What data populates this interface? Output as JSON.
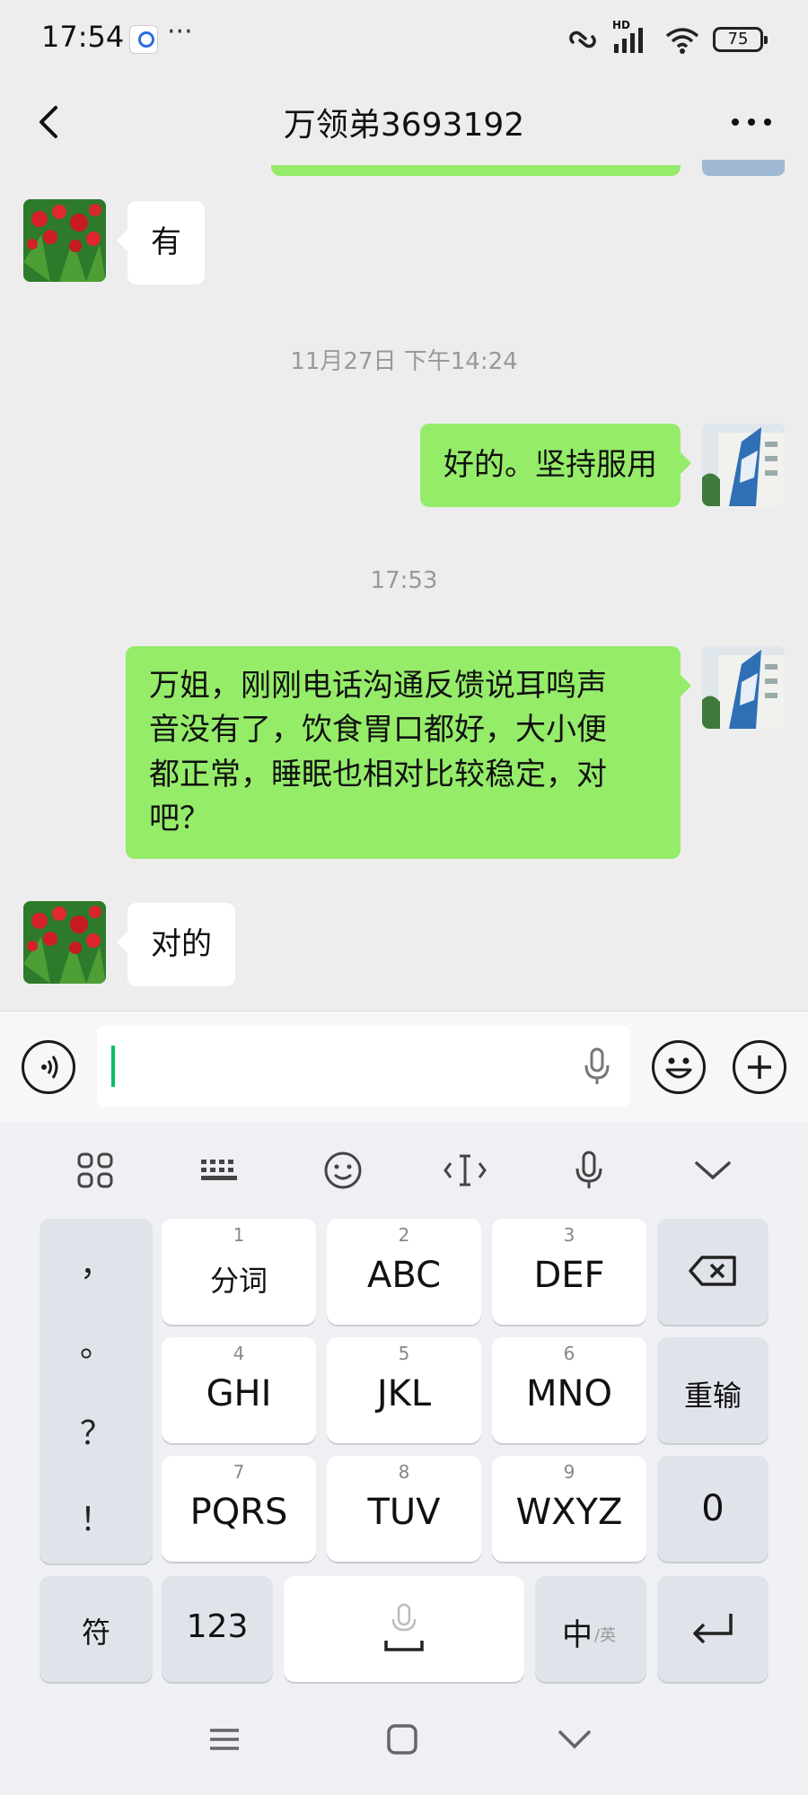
{
  "status_bar": {
    "time": "17:54",
    "more": "···",
    "network": "HD",
    "battery": "75"
  },
  "header": {
    "title": "万领弟3693192"
  },
  "messages": [
    {
      "side": "in",
      "text": "有"
    },
    {
      "type": "time",
      "text": "11月27日 下午14:24"
    },
    {
      "side": "out",
      "text": "好的。坚持服用"
    },
    {
      "type": "time",
      "text": "17:53"
    },
    {
      "side": "out",
      "lines": [
        "万姐，刚刚电话沟通反馈说耳鸣声",
        "音没有了，饮食胃口都好，大小便",
        "都正常，睡眠也相对比较稳定，对",
        "吧？"
      ]
    },
    {
      "side": "in",
      "text": "对的"
    }
  ],
  "input": {
    "value": ""
  },
  "keyboard": {
    "toolbar": [
      "grid-icon",
      "keyboard-icon",
      "emoji-icon",
      "cursor-icon",
      "mic-icon",
      "collapse-icon"
    ],
    "punctuation": [
      "，",
      "。",
      "？",
      "！"
    ],
    "keys": [
      {
        "num": "1",
        "label": "分词"
      },
      {
        "num": "2",
        "label": "ABC"
      },
      {
        "num": "3",
        "label": "DEF"
      },
      {
        "num": "4",
        "label": "GHI"
      },
      {
        "num": "5",
        "label": "JKL"
      },
      {
        "num": "6",
        "label": "MNO"
      },
      {
        "num": "7",
        "label": "PQRS"
      },
      {
        "num": "8",
        "label": "TUV"
      },
      {
        "num": "9",
        "label": "WXYZ"
      }
    ],
    "reenter": "重输",
    "zero": "0",
    "symbols": "符",
    "numbers": "123",
    "lang_main": "中",
    "lang_alt": "/英"
  }
}
